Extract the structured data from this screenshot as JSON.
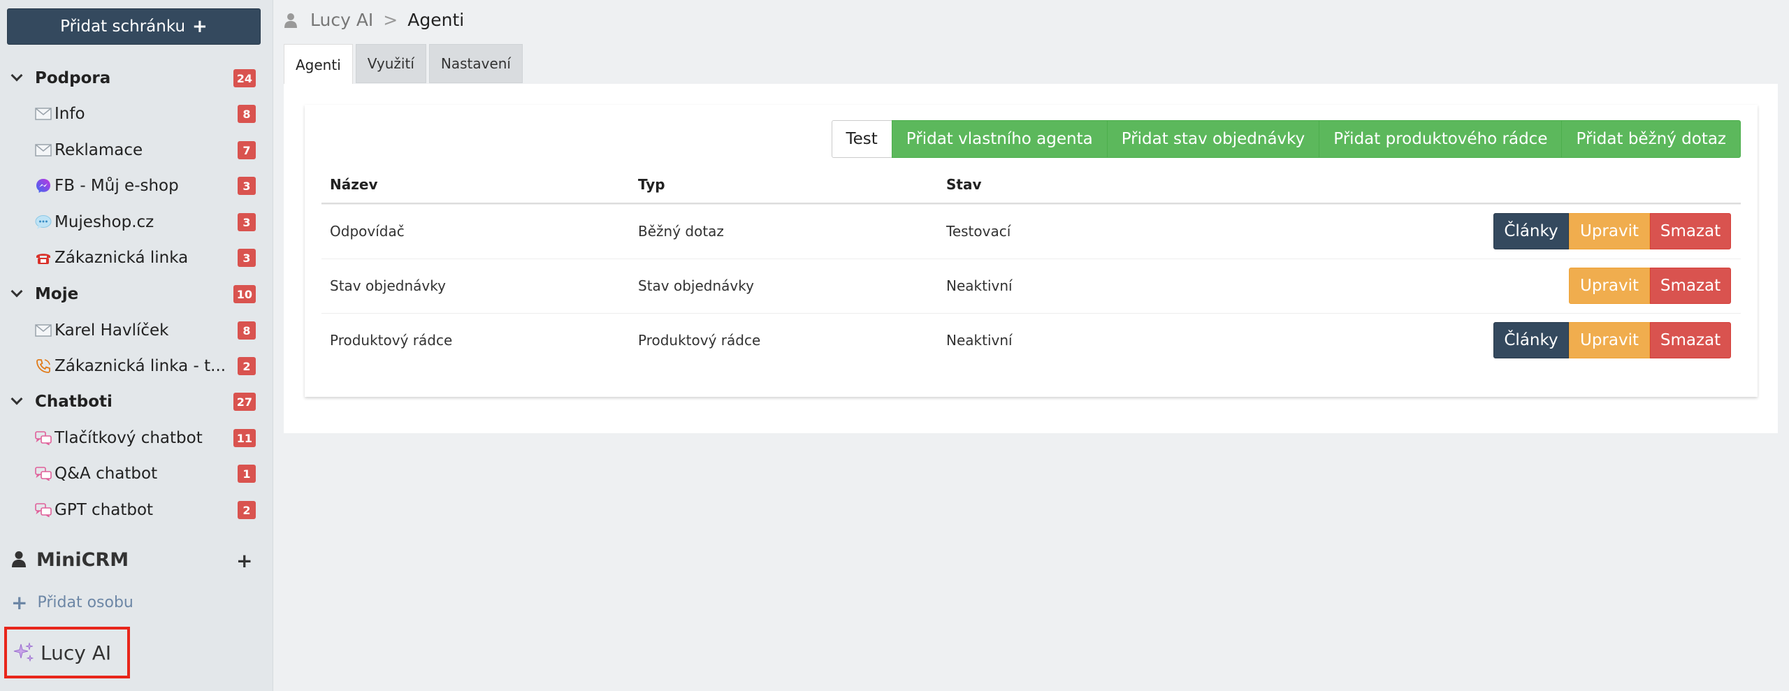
{
  "sidebar": {
    "add_mailbox_label": "Přidat schránku",
    "groups": [
      {
        "name": "Podpora",
        "count": "24",
        "items": [
          {
            "label": "Info",
            "count": "8",
            "icon": "envelope-icon"
          },
          {
            "label": "Reklamace",
            "count": "7",
            "icon": "envelope-icon"
          },
          {
            "label": "FB - Můj e-shop",
            "count": "3",
            "icon": "messenger-icon"
          },
          {
            "label": "Mujeshop.cz",
            "count": "3",
            "icon": "chat-bubble-icon"
          },
          {
            "label": "Zákaznická linka",
            "count": "3",
            "icon": "telephone-icon"
          }
        ]
      },
      {
        "name": "Moje",
        "count": "10",
        "items": [
          {
            "label": "Karel Havlíček",
            "count": "8",
            "icon": "envelope-icon"
          },
          {
            "label": "Zákaznická linka - t...",
            "count": "2",
            "icon": "phone-icon"
          }
        ]
      },
      {
        "name": "Chatboti",
        "count": "27",
        "items": [
          {
            "label": "Tlačítkový chatbot",
            "count": "11",
            "icon": "chat-icon"
          },
          {
            "label": "Q&A chatbot",
            "count": "1",
            "icon": "chat-icon"
          },
          {
            "label": "GPT chatbot",
            "count": "2",
            "icon": "chat-icon"
          }
        ]
      }
    ],
    "minicrm_label": "MiniCRM",
    "add_person_label": "Přidat osobu",
    "lucy_label": "Lucy AI"
  },
  "breadcrumb": {
    "root": "Lucy AI",
    "separator": ">",
    "current": "Agenti"
  },
  "tabs": [
    {
      "label": "Agenti"
    },
    {
      "label": "Využití"
    },
    {
      "label": "Nastavení"
    }
  ],
  "toolbar": {
    "test_label": "Test",
    "add_custom": "Přidat vlastního agenta",
    "add_order_status": "Přidat stav objednávky",
    "add_product_advisor": "Přidat produktového rádce",
    "add_common_query": "Přidat běžný dotaz"
  },
  "table": {
    "headers": {
      "name": "Název",
      "type": "Typ",
      "status": "Stav"
    },
    "rows": [
      {
        "name": "Odpovídač",
        "type": "Běžný dotaz",
        "status": "Testovací"
      },
      {
        "name": "Stav objednávky",
        "type": "Stav objednávky",
        "status": "Neaktivní"
      },
      {
        "name": "Produktový rádce",
        "type": "Produktový rádce",
        "status": "Neaktivní"
      }
    ],
    "actions": {
      "articles": "Články",
      "edit": "Upravit",
      "delete": "Smazat"
    }
  },
  "colors": {
    "primary_dark": "#34495e",
    "success": "#5cb85c",
    "warning": "#f0ad4e",
    "danger": "#d9534f",
    "highlight": "#e8261b"
  }
}
